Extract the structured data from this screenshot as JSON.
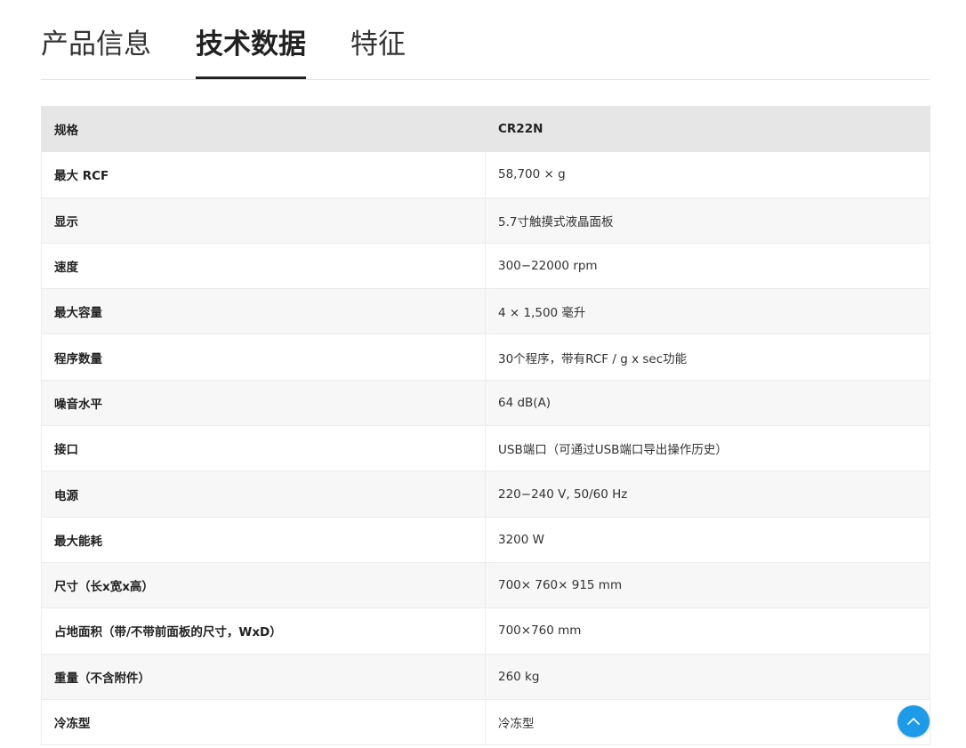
{
  "tabs": [
    {
      "label": "产品信息",
      "active": false
    },
    {
      "label": "技术数据",
      "active": true
    },
    {
      "label": "特征",
      "active": false
    }
  ],
  "table": {
    "header": {
      "key": "规格",
      "value": "CR22N"
    },
    "rows": [
      {
        "key": "最大 RCF",
        "value": "58,700 × g"
      },
      {
        "key": "显示",
        "value": "5.7寸触摸式液晶面板"
      },
      {
        "key": "速度",
        "value": "300−22000 rpm"
      },
      {
        "key": "最大容量",
        "value": "4 × 1,500 毫升"
      },
      {
        "key": "程序数量",
        "value": "30个程序，带有RCF / g x sec功能"
      },
      {
        "key": "噪音水平",
        "value": "64 dB(A)"
      },
      {
        "key": "接口",
        "value": "USB端口（可通过USB端口导出操作历史）"
      },
      {
        "key": "电源",
        "value": "220−240 V, 50/60 Hz"
      },
      {
        "key": "最大能耗",
        "value": "3200 W"
      },
      {
        "key": "尺寸（长x宽x高）",
        "value": "700× 760× 915 mm"
      },
      {
        "key": "占地面积（带/不带前面板的尺寸，WxD）",
        "value": "700×760 mm"
      },
      {
        "key": "重量（不含附件）",
        "value": "260 kg"
      },
      {
        "key": "冷冻型",
        "value": "冷冻型"
      }
    ]
  },
  "scroll_top": {
    "icon": "chevron-up-icon",
    "color": "#1e9be8"
  }
}
